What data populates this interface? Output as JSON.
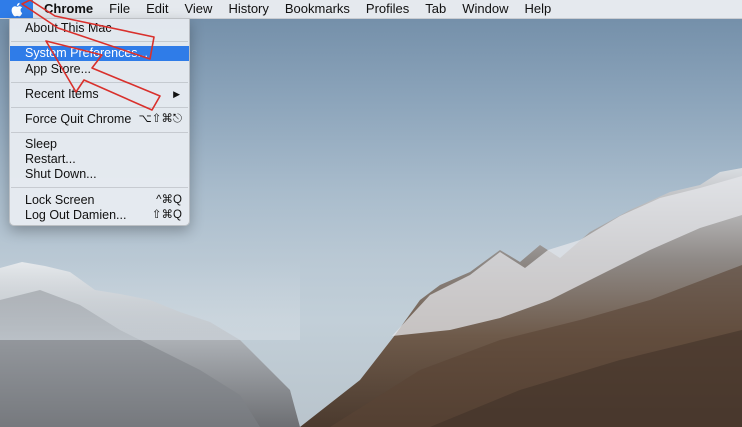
{
  "menubar": {
    "apple_icon": "apple-logo",
    "app_name": "Chrome",
    "items": [
      "File",
      "Edit",
      "View",
      "History",
      "Bookmarks",
      "Profiles",
      "Tab",
      "Window",
      "Help"
    ]
  },
  "apple_menu": {
    "about": "About This Mac",
    "system_preferences": "System Preferences...",
    "app_store": "App Store...",
    "recent_items": "Recent Items",
    "force_quit": "Force Quit Chrome",
    "force_quit_shortcut": "⌥⇧⌘⎋",
    "sleep": "Sleep",
    "restart": "Restart...",
    "shut_down": "Shut Down...",
    "lock_screen": "Lock Screen",
    "lock_screen_shortcut": "^⌘Q",
    "log_out": "Log Out Damien...",
    "log_out_shortcut": "⇧⌘Q"
  },
  "colors": {
    "highlight": "#2f7ce8",
    "annotation": "#d9302c"
  }
}
